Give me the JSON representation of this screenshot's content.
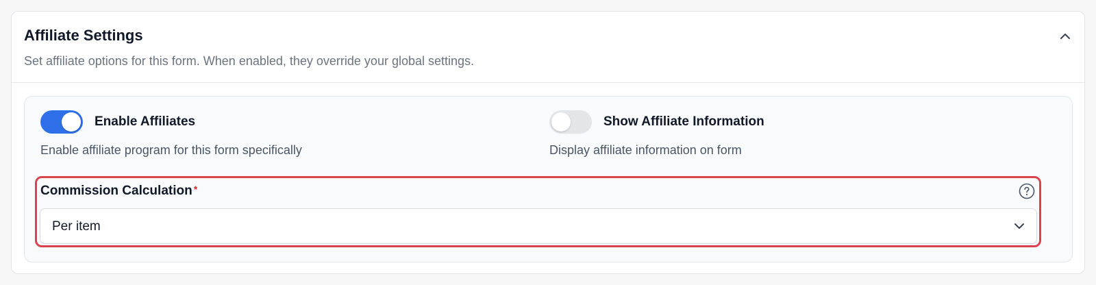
{
  "section": {
    "title": "Affiliate Settings",
    "subtitle": "Set affiliate options for this form. When enabled, they override your global settings.",
    "collapse_icon": "chevron-up-icon"
  },
  "toggles": [
    {
      "label": "Enable Affiliates",
      "description": "Enable affiliate program for this form specifically",
      "enabled": true
    },
    {
      "label": "Show Affiliate Information",
      "description": "Display affiliate information on form",
      "enabled": false
    }
  ],
  "commission": {
    "label": "Commission Calculation",
    "required_mark": "*",
    "help_icon": "question-circle-icon",
    "selected_value": "Per item",
    "dropdown_icon": "chevron-down-icon"
  },
  "colors": {
    "accent": "#2f6fe8",
    "highlight_border": "#d9434e",
    "required": "#dc2626"
  }
}
